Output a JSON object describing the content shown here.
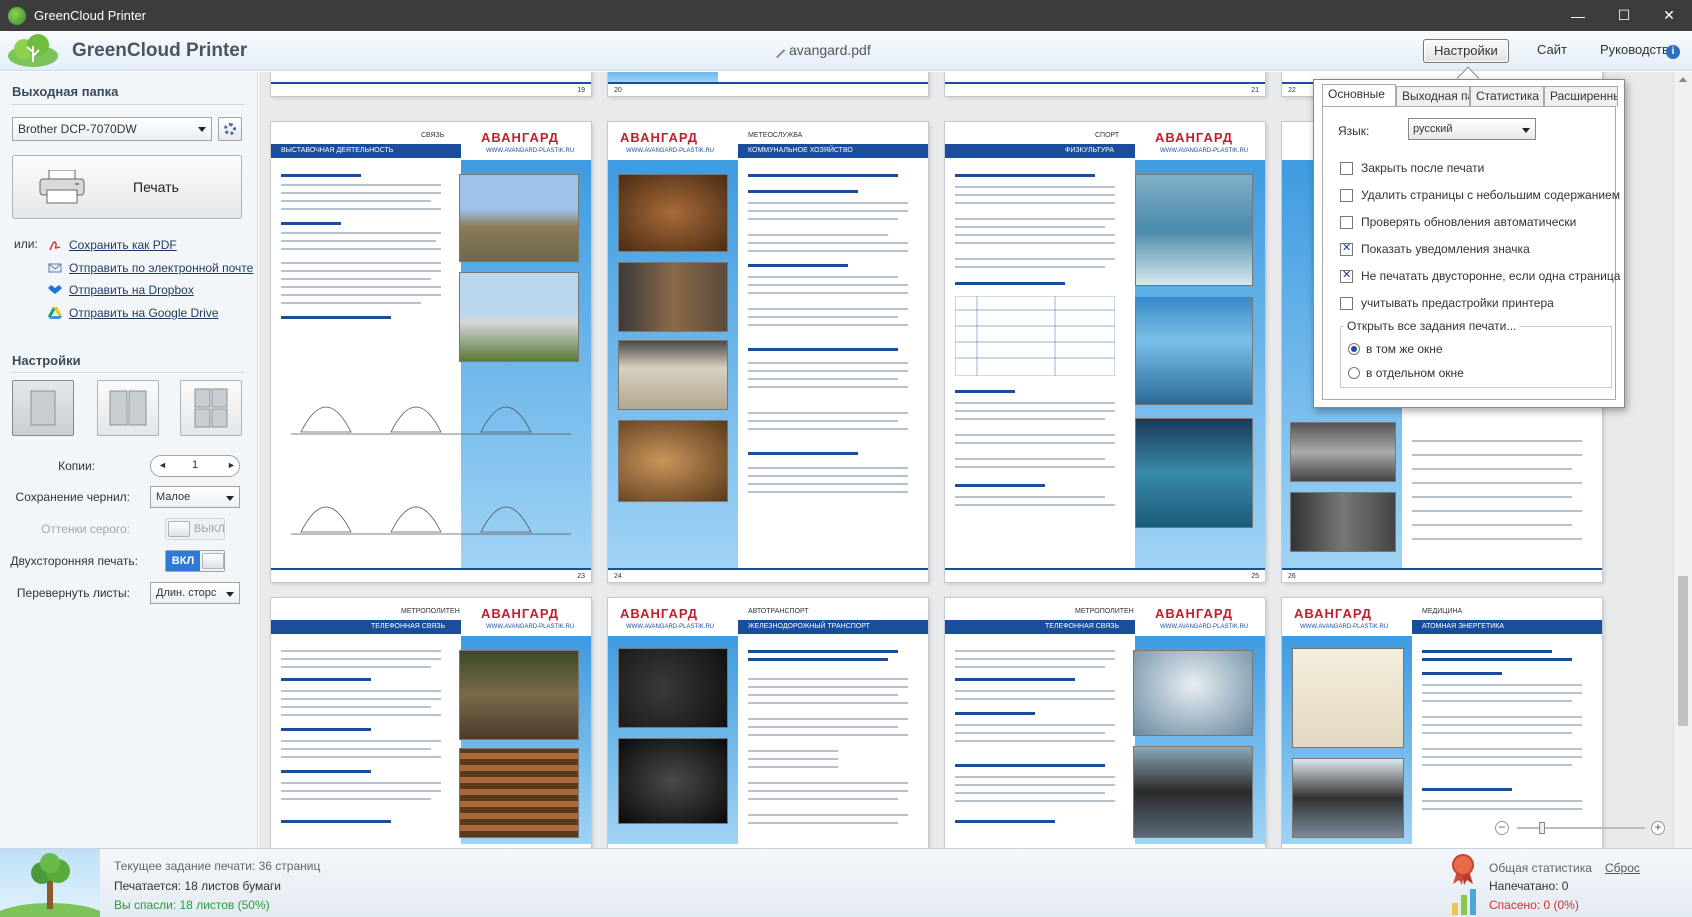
{
  "window": {
    "title": "GreenCloud Printer",
    "minimize": "—",
    "maximize": "☐",
    "close": "✕"
  },
  "header": {
    "brand": "GreenCloud Printer",
    "document": "avangard.pdf",
    "settings_label": "Настройки",
    "site_label": "Сайт",
    "guide_label": "Руководство",
    "info_glyph": "i"
  },
  "sidebar": {
    "output_title": "Выходная папка",
    "printer": "Brother DCP-7070DW",
    "print_label": "Печать",
    "or_label": "или:",
    "links": [
      {
        "label": "Сохранить как PDF",
        "icon": "pdf-icon"
      },
      {
        "label": "Отправить по электронной почте",
        "icon": "mail-icon"
      },
      {
        "label": "Отправить на Dropbox",
        "icon": "dropbox-icon"
      },
      {
        "label": "Отправить на Google Drive",
        "icon": "google-drive-icon"
      }
    ],
    "settings_title": "Настройки",
    "copies_label": "Копии:",
    "copies_value": "1",
    "copies_dec": "◄",
    "copies_inc": "►",
    "ink_label": "Сохранение чернил:",
    "ink_value": "Малое",
    "gray_label": "Оттенки серого:",
    "gray_value": "ВЫКЛ",
    "duplex_label": "Двухсторонняя печать:",
    "duplex_value": "ВКЛ",
    "flip_label": "Перевернуть листы:",
    "flip_value": "Длин. сторс"
  },
  "pages": {
    "row1_nums": [
      "19",
      "20",
      "21",
      "22"
    ],
    "row2": [
      {
        "topic": "СВЯЗЬ",
        "subtopic": "ВЫСТАВОЧНАЯ ДЕЯТЕЛЬНОСТЬ",
        "num": "23"
      },
      {
        "topic": "МЕТЕОСЛУЖБА",
        "subtopic": "КОММУНАЛЬНОЕ ХОЗЯЙСТВО",
        "num": "24"
      },
      {
        "topic": "СПОРТ",
        "subtopic": "ФИЗКУЛЬТУРА",
        "num": "25"
      },
      {
        "topic": "",
        "subtopic": "",
        "num": "26"
      }
    ],
    "row3": [
      {
        "topic": "МЕТРОПОЛИТЕН",
        "subtopic": "ТЕЛЕФОННАЯ СВЯЗЬ"
      },
      {
        "topic": "АВТОТРАНСПОРТ",
        "subtopic": "ЖЕЛЕЗНОДОРОЖНЫЙ ТРАНСПОРТ"
      },
      {
        "topic": "МЕТРОПОЛИТЕН",
        "subtopic": "ТЕЛЕФОННАЯ СВЯЗЬ"
      },
      {
        "topic": "МЕДИЦИНА",
        "subtopic": "АТОМНАЯ ЭНЕРГЕТИКА"
      }
    ],
    "logo_text": "АВАНГАРД",
    "logo_url": "WWW.AVANGARD-PLASTIK.RU"
  },
  "settings_popup": {
    "tabs": [
      "Основные",
      "Выходная папка",
      "Статистика",
      "Расширенные"
    ],
    "language_label": "Язык:",
    "language_value": "русский",
    "options": [
      {
        "label": "Закрыть после печати",
        "checked": false
      },
      {
        "label": "Удалить страницы с небольшим содержанием",
        "checked": false
      },
      {
        "label": "Проверять обновления автоматически",
        "checked": false
      },
      {
        "label": "Показать уведомления значка",
        "checked": true
      },
      {
        "label": "Не печатать двусторонне, если одна страница",
        "checked": true
      },
      {
        "label": "учитывать предастройки принтера",
        "checked": false
      }
    ],
    "group_title": "Открыть все задания печати...",
    "radios": [
      {
        "label": "в том же окне",
        "checked": true
      },
      {
        "label": "в отдельном окне",
        "checked": false
      }
    ]
  },
  "zoom": {
    "minus": "−",
    "plus": "+"
  },
  "status": {
    "job": "Текущее задание печати: 36 страниц",
    "printing": "Печатается: 18 листов бумаги",
    "saved": "Вы спасли: 18 листов (50%)",
    "total_stats": "Общая статистика",
    "reset": "Сброс",
    "printed": "Напечатано: 0",
    "saved_total": "Спасено: 0 (0%)"
  },
  "colors": {
    "accent": "#2d7bd6",
    "brand_blue": "#1a4e9a",
    "logo_red": "#c21f2e",
    "saved_green": "#2b9a3a",
    "saved_red": "#d0342c"
  }
}
